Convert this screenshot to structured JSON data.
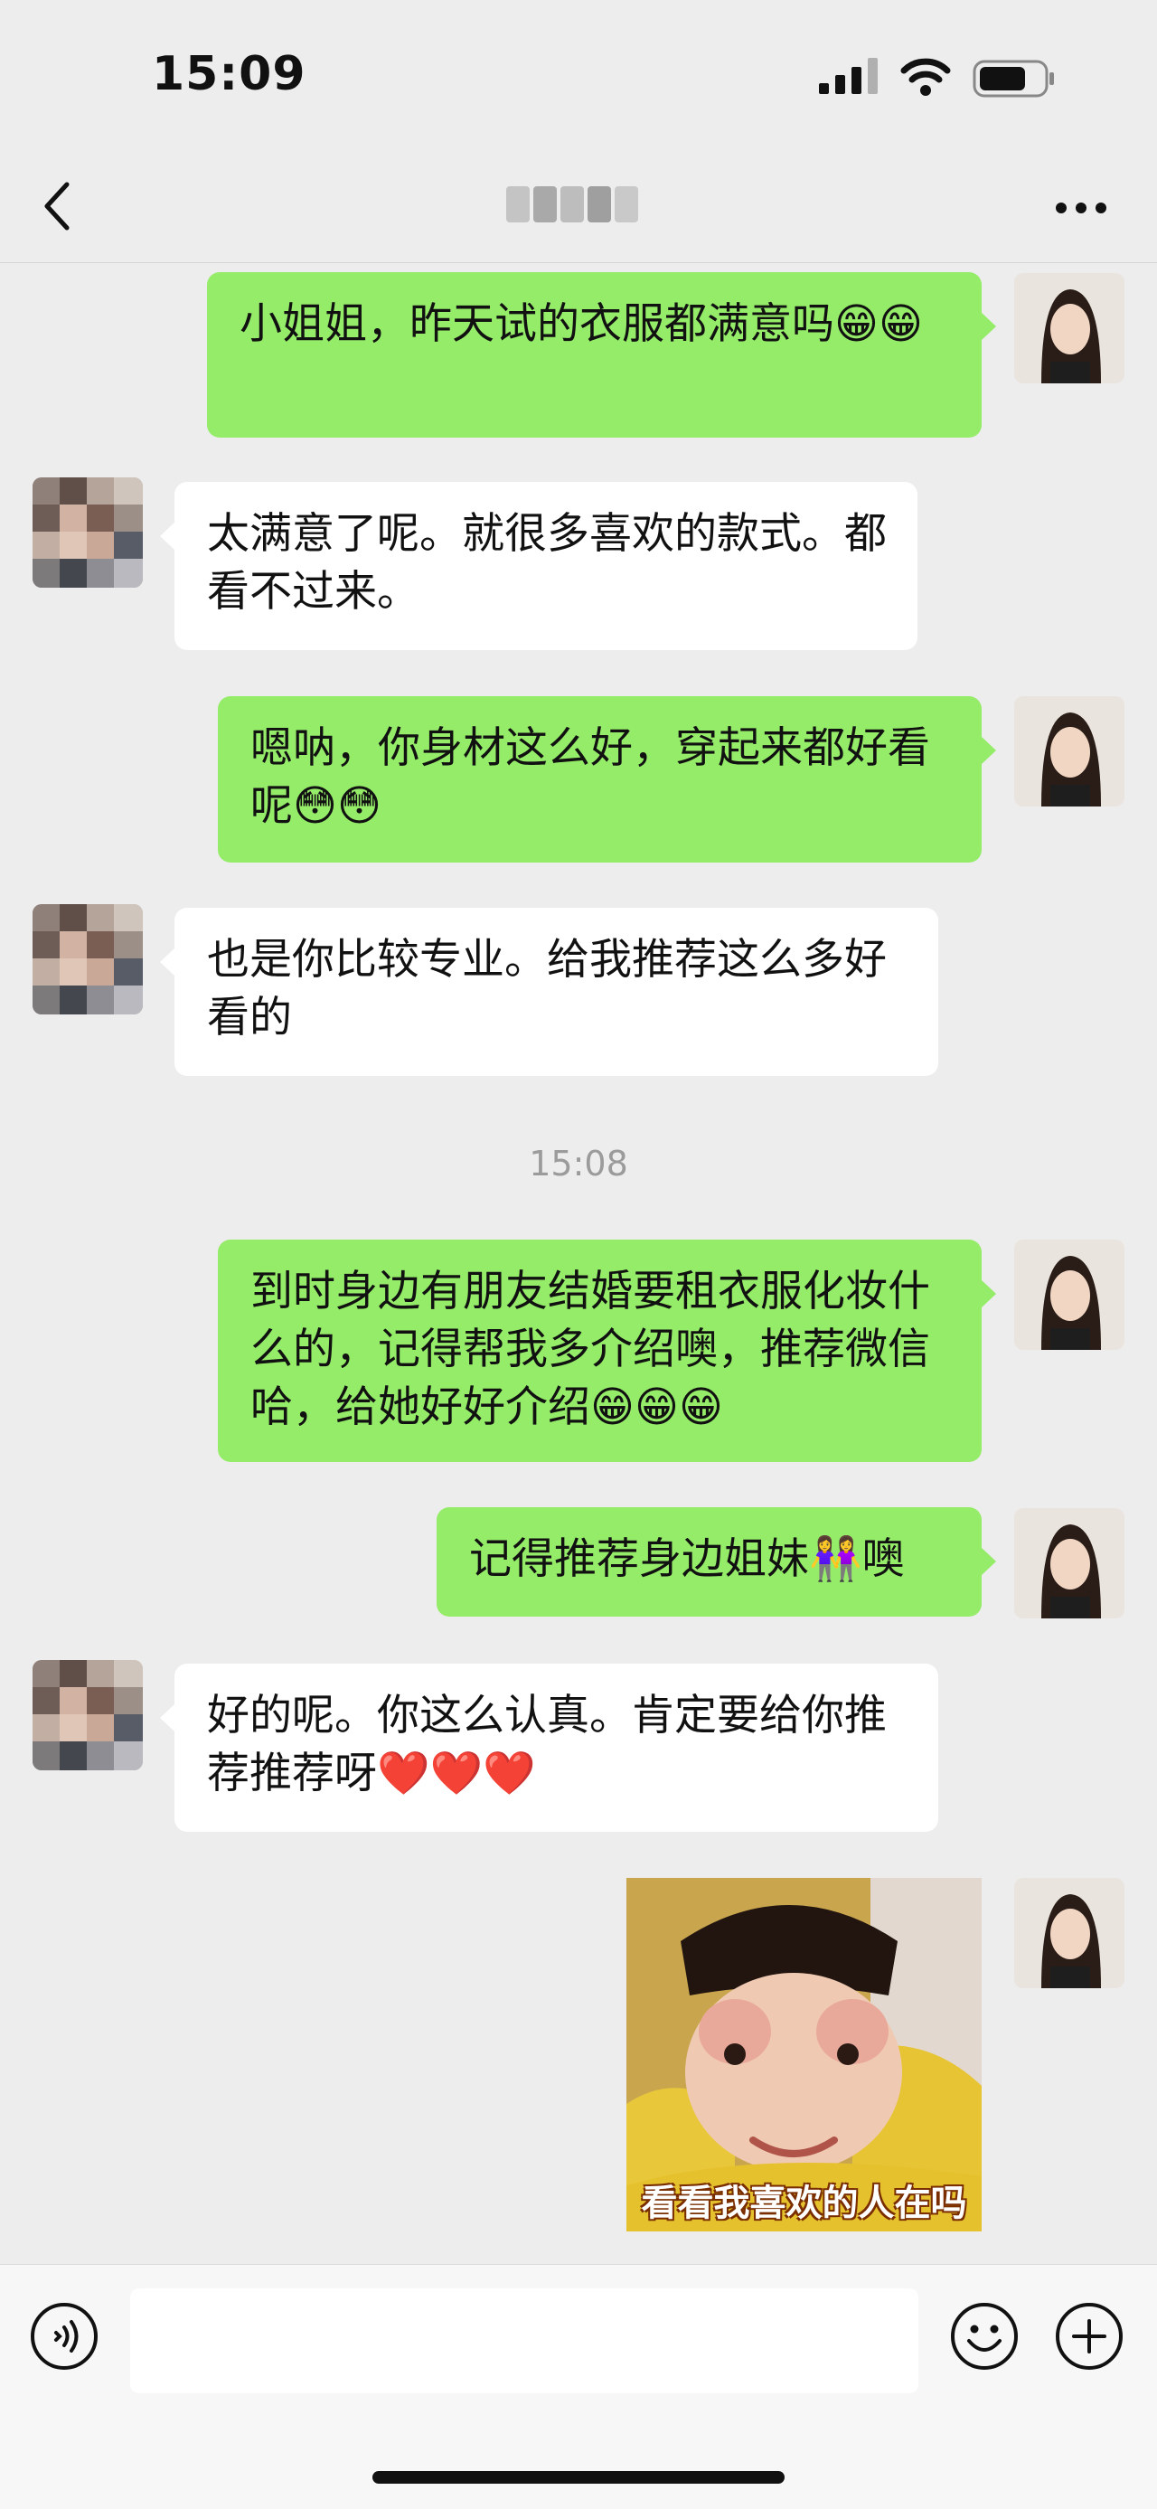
{
  "status_bar": {
    "time": "15:09"
  },
  "nav": {
    "title_blurred": true
  },
  "messages": [
    {
      "side": "right",
      "text": "小姐姐，昨天试的衣服都满意吗😁😁"
    },
    {
      "side": "left",
      "text": "太满意了呢。就很多喜欢的款式。都看不过来。"
    },
    {
      "side": "right",
      "text": "嗯呐，你身材这么好，穿起来都好看呢😳😳"
    },
    {
      "side": "left",
      "text": "也是你比较专业。给我推荐这么多好看的"
    },
    {
      "timestamp": "15:08"
    },
    {
      "side": "right",
      "text": "到时身边有朋友结婚要租衣服化妆什么的，记得帮我多介绍噢，推荐微信哈，给她好好介绍😁😁😁"
    },
    {
      "side": "right",
      "text": "记得推荐身边姐妹👭噢"
    },
    {
      "side": "left",
      "text": "好的呢。你这么认真。肯定要给你推荐推荐呀❤️❤️❤️"
    },
    {
      "side": "right",
      "type": "sticker",
      "caption": "看看我喜欢的人在吗"
    }
  ],
  "input_bar": {
    "placeholder": ""
  },
  "icons": {
    "back": "chevron-left-icon",
    "more": "more-icon",
    "voice": "voice-icon",
    "emoji": "emoji-icon",
    "plus": "plus-icon"
  },
  "colors": {
    "background": "#ededed",
    "bubble_self": "#95ec69",
    "bubble_other": "#ffffff",
    "timestamp": "#9b9b9b"
  }
}
